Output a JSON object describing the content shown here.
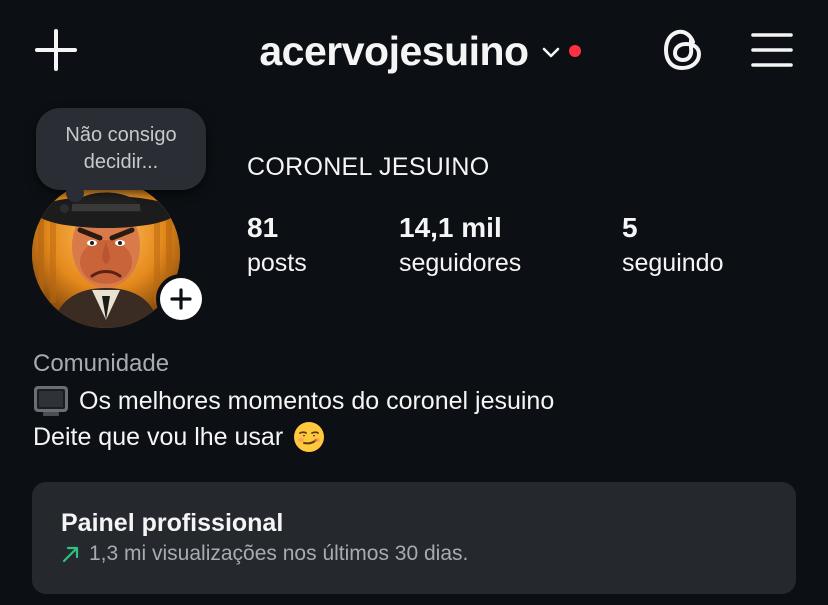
{
  "header": {
    "username": "acervojesuino",
    "notification_color": "#ff3040",
    "icons": [
      "plus-icon",
      "chevron-down-icon",
      "threads-icon",
      "hamburger-menu-icon"
    ]
  },
  "profile": {
    "note": "Não consigo decidir...",
    "display_name": "CORONEL JESUINO",
    "stats": [
      {
        "value": "81",
        "label": "posts"
      },
      {
        "value": "14,1 mil",
        "label": "seguidores"
      },
      {
        "value": "5",
        "label": "seguindo"
      }
    ],
    "category": "Comunidade",
    "bio": [
      "Os melhores momentos do coronel jesuino",
      "Deite que vou lhe usar"
    ]
  },
  "dashboard": {
    "title": "Painel profissional",
    "subtitle": "1,3 mi visualizações nos últimos 30 dias.",
    "trend_color": "#2ec27e"
  }
}
